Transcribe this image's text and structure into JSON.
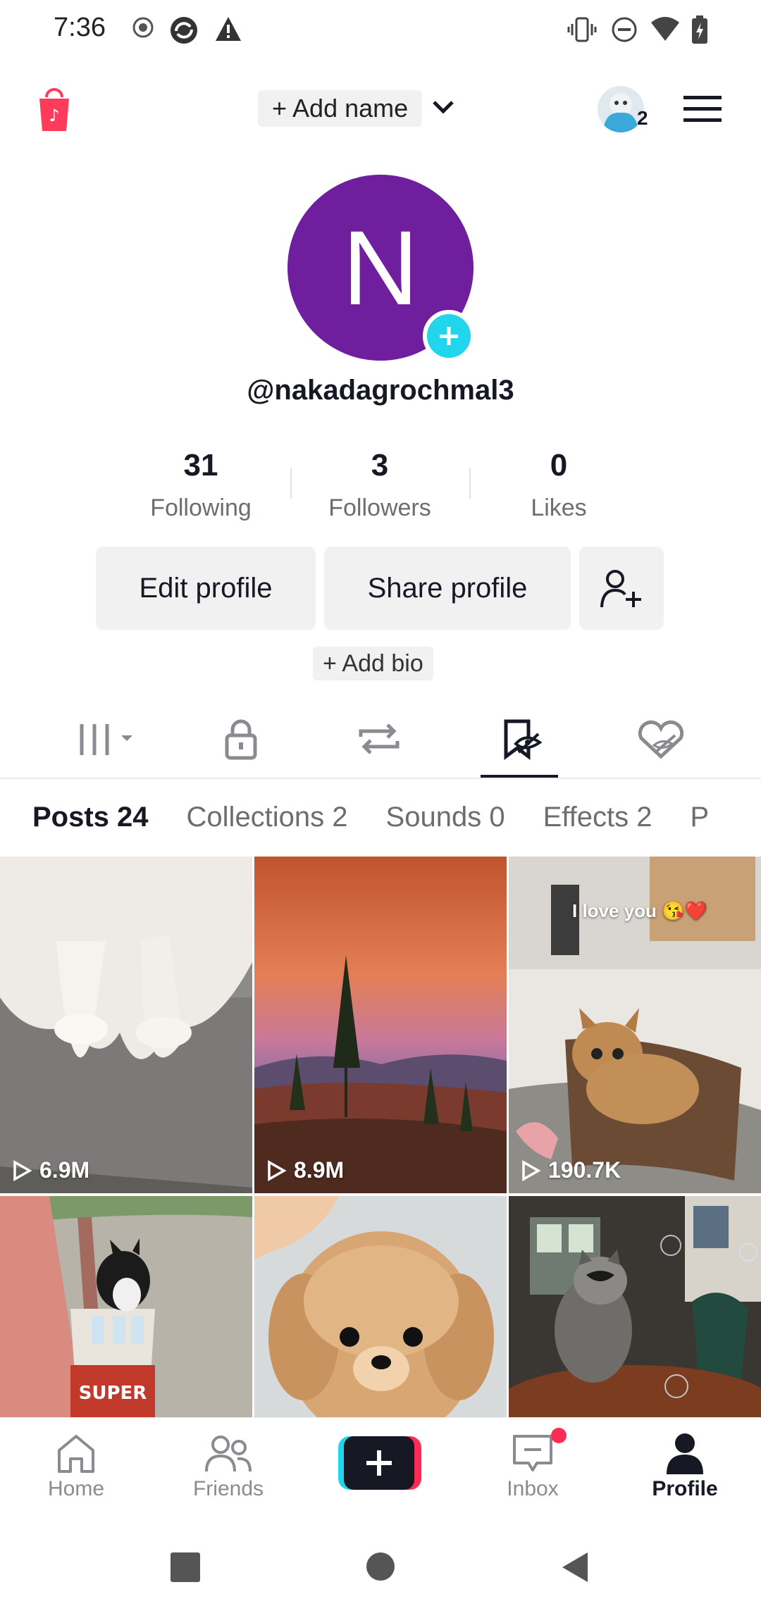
{
  "status_bar": {
    "time": "7:36"
  },
  "header": {
    "add_name": "+ Add name",
    "notification_count": "2"
  },
  "profile": {
    "avatar_letter": "N",
    "username": "@nakadagrochmal3",
    "stats": [
      {
        "value": "31",
        "label": "Following"
      },
      {
        "value": "3",
        "label": "Followers"
      },
      {
        "value": "0",
        "label": "Likes"
      }
    ],
    "edit_button": "Edit profile",
    "share_button": "Share profile",
    "add_bio": "+ Add bio"
  },
  "content_tabs": [
    "grid-menu-icon",
    "lock-icon",
    "repost-icon",
    "favorites-icon",
    "liked-icon"
  ],
  "sub_tabs": [
    {
      "label": "Posts 24"
    },
    {
      "label": "Collections 2"
    },
    {
      "label": "Sounds 0"
    },
    {
      "label": "Effects 2"
    },
    {
      "label": "P"
    }
  ],
  "videos": [
    {
      "views": "6.9M"
    },
    {
      "views": "8.9M"
    },
    {
      "views": "190.7K",
      "caption": "I love you 😘❤️"
    },
    {
      "views": ""
    },
    {
      "views": ""
    },
    {
      "views": ""
    }
  ],
  "bottom_nav": {
    "home": "Home",
    "friends": "Friends",
    "inbox": "Inbox",
    "profile": "Profile"
  },
  "colors": {
    "avatar": "#6f1e9e",
    "accent_cyan": "#20d5ec",
    "accent_red": "#fe2c55"
  }
}
